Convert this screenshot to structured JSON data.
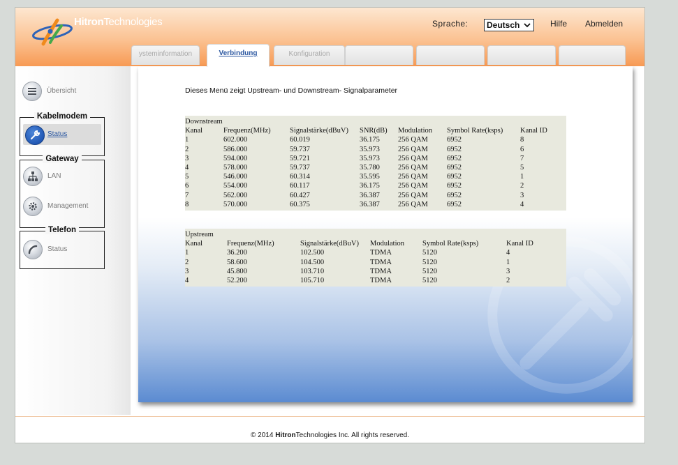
{
  "header": {
    "brand_bold": "Hitron",
    "brand_light": "Technologies",
    "language_label": "Sprache:",
    "language_value": "Deutsch",
    "help_label": "Hilfe",
    "logout_label": "Abmelden"
  },
  "tabs": [
    {
      "label": "ysteminformation",
      "active": false
    },
    {
      "label": "Verbindung",
      "active": true
    },
    {
      "label": "Konfiguration",
      "active": false
    },
    {
      "label": "",
      "active": false
    },
    {
      "label": "",
      "active": false
    },
    {
      "label": "",
      "active": false
    },
    {
      "label": "",
      "active": false
    }
  ],
  "sidebar": {
    "overview_label": "Übersicht",
    "kabelmodem": {
      "title": "Kabelmodem",
      "status_label": "Status"
    },
    "gateway": {
      "title": "Gateway",
      "lan_label": "LAN",
      "management_label": "Management"
    },
    "telefon": {
      "title": "Telefon",
      "status_label": "Status"
    }
  },
  "main": {
    "intro": "Dieses Menü zeigt Upstream- und Downstream- Signalparameter",
    "downstream": {
      "caption": "Downstream",
      "columns": [
        "Kanal",
        "Frequenz(MHz)",
        "Signalstärke(dBuV)",
        "SNR(dB)",
        "Modulation",
        "Symbol Rate(ksps)",
        "Kanal ID"
      ],
      "rows": [
        [
          "1",
          "602.000",
          "60.019",
          "36.175",
          "256 QAM",
          "6952",
          "8"
        ],
        [
          "2",
          "586.000",
          "59.737",
          "35.973",
          "256 QAM",
          "6952",
          "6"
        ],
        [
          "3",
          "594.000",
          "59.721",
          "35.973",
          "256 QAM",
          "6952",
          "7"
        ],
        [
          "4",
          "578.000",
          "59.737",
          "35.780",
          "256 QAM",
          "6952",
          "5"
        ],
        [
          "5",
          "546.000",
          "60.314",
          "35.595",
          "256 QAM",
          "6952",
          "1"
        ],
        [
          "6",
          "554.000",
          "60.117",
          "36.175",
          "256 QAM",
          "6952",
          "2"
        ],
        [
          "7",
          "562.000",
          "60.427",
          "36.387",
          "256 QAM",
          "6952",
          "3"
        ],
        [
          "8",
          "570.000",
          "60.375",
          "36.387",
          "256 QAM",
          "6952",
          "4"
        ]
      ]
    },
    "upstream": {
      "caption": "Upstream",
      "columns": [
        "Kanal",
        "Frequenz(MHz)",
        "Signalstärke(dBuV)",
        "Modulation",
        "Symbol Rate(ksps)",
        "Kanal ID"
      ],
      "rows": [
        [
          "1",
          "36.200",
          "102.500",
          "TDMA",
          "5120",
          "4"
        ],
        [
          "2",
          "58.600",
          "104.500",
          "TDMA",
          "5120",
          "1"
        ],
        [
          "3",
          "45.800",
          "103.710",
          "TDMA",
          "5120",
          "3"
        ],
        [
          "4",
          "52.200",
          "105.710",
          "TDMA",
          "5120",
          "2"
        ]
      ]
    }
  },
  "footer": {
    "copyright_prefix": "© 2014",
    "brand_bold": "Hitron",
    "brand_light": "Technologies",
    "copyright_suffix": "Inc.  All rights reserved."
  }
}
